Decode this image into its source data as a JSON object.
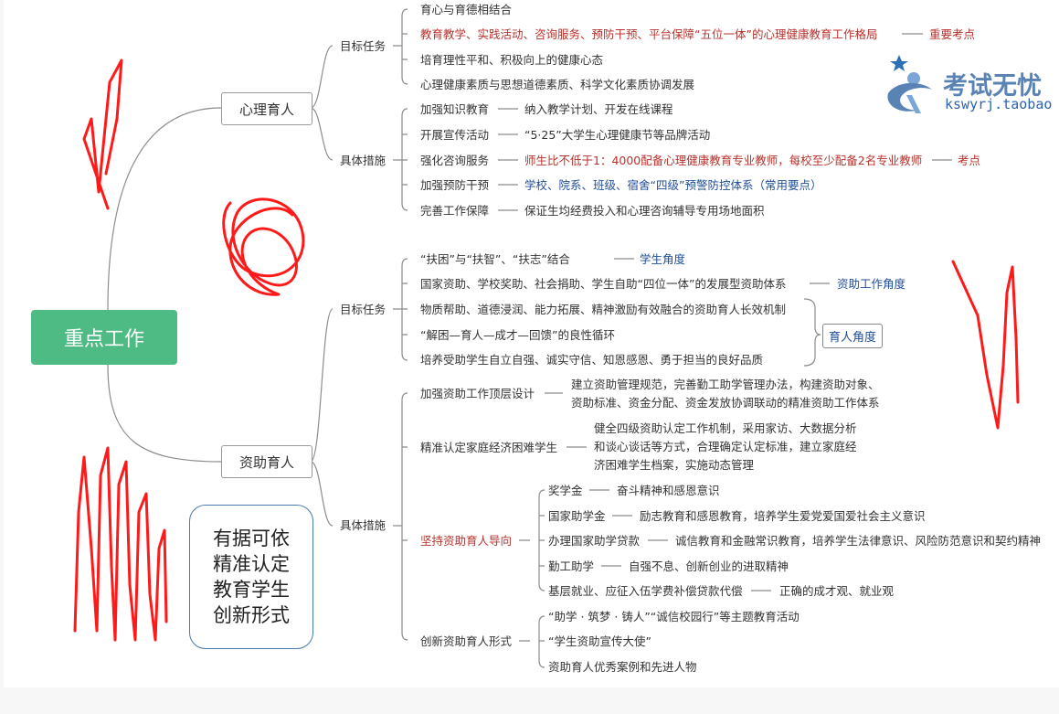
{
  "root": "重点工作",
  "branches": {
    "psych": {
      "label": "心理育人",
      "goals": {
        "label": "目标任务",
        "items": [
          "育心与育德相结合",
          "教育教学、实践活动、咨询服务、预防干预、平台保障“五位一体”的心理健康教育工作格局",
          "培育理性平和、积极向上的健康心态",
          "心理健康素质与思想道德素质、科学文化素质协调发展"
        ],
        "key_point": "重要考点"
      },
      "measures": {
        "label": "具体措施",
        "items": [
          {
            "name": "加强知识教育",
            "desc": "纳入教学计划、开发在线课程"
          },
          {
            "name": "开展宣传活动",
            "desc": "“5·25”大学生心理健康节等品牌活动"
          },
          {
            "name": "强化咨询服务",
            "desc": "师生比不低于1：4000配备心理健康教育专业教师，每校至少配备2名专业教师",
            "tag": "考点"
          },
          {
            "name": "加强预防干预",
            "desc": "学校、院系、班级、宿舍“四级”预警防控体系（常用要点）"
          },
          {
            "name": "完善工作保障",
            "desc": "保证生均经费投入和心理咨询辅导专用场地面积"
          }
        ]
      }
    },
    "aid": {
      "label": "资助育人",
      "goals": {
        "label": "目标任务",
        "items": [
          {
            "text": "“扶困”与“扶智”、“扶志”结合",
            "tag": "学生角度"
          },
          {
            "text": "国家资助、学校奖助、社会捐助、学生自助“四位一体”的发展型资助体系",
            "tag": "资助工作角度"
          },
          {
            "text": "物质帮助、道德浸润、能力拓展、精神激励有效融合的资助育人长效机制"
          },
          {
            "text": "“解困—育人—成才—回馈”的良性循环"
          },
          {
            "text": "培养受助学生自立自强、诚实守信、知恩感恩、勇于担当的良好品质"
          }
        ],
        "group_tag": "育人角度"
      },
      "measures": {
        "label": "具体措施",
        "top_design": {
          "name": "加强资助工作顶层设计",
          "lines": [
            "建立资助管理规范，完善勤工助学管理办法，构建资助对象、",
            "资助标准、资金分配、资金发放协调联动的精准资助工作体系"
          ]
        },
        "identify": {
          "name": "精准认定家庭经济困难学生",
          "lines": [
            "健全四级资助认定工作机制，采用家访、大数据分析",
            "和谈心谈话等方式，合理确定认定标准，建立家庭经",
            "济困难学生档案，实施动态管理"
          ]
        },
        "guidance": {
          "name": "坚持资助育人导向",
          "items": [
            {
              "name": "奖学金",
              "desc": "奋斗精神和感恩意识"
            },
            {
              "name": "国家助学金",
              "desc": "励志教育和感恩教育，培养学生爱党爱国爱社会主义意识"
            },
            {
              "name": "办理国家助学贷款",
              "desc": "诚信教育和金融常识教育，培养学生法律意识、风险防范意识和契约精神"
            },
            {
              "name": "勤工助学",
              "desc": "自强不息、创新创业的进取精神"
            },
            {
              "name": "基层就业、应征入伍学费补偿贷款代偿",
              "desc": "正确的成才观、就业观"
            }
          ]
        },
        "innovate": {
          "name": "创新资助育人形式",
          "items": [
            "“助学 · 筑梦 · 铸人”“诚信校园行”等主题教育活动",
            "“学生资助宣传大使”",
            "资助育人优秀案例和先进人物"
          ]
        }
      }
    }
  },
  "note_lines": [
    "有据可依",
    "精准认定",
    "教育学生",
    "创新形式"
  ],
  "watermark": {
    "title": "考试无忧",
    "url": "kswyrj.taobao"
  },
  "colors": {
    "root": "#4dbb83",
    "emphasis": "#b8322d",
    "tag": "#1f4e9a",
    "scribble": "#ff1a1a",
    "line": "#8c8c8c"
  }
}
